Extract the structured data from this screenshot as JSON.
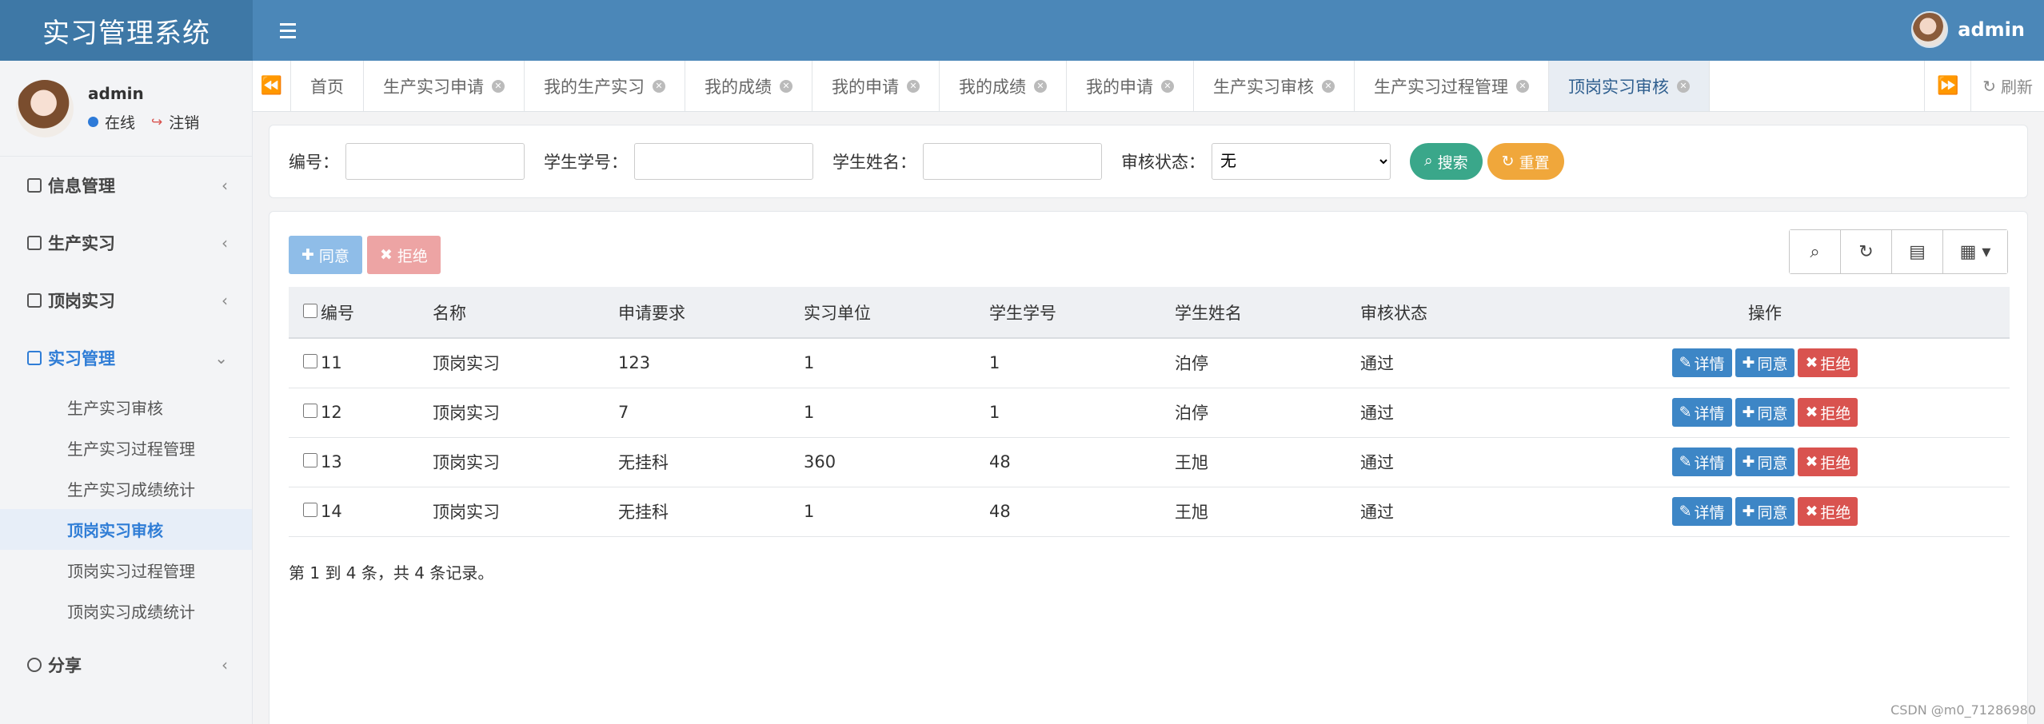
{
  "app": {
    "title": "实习管理系统"
  },
  "header": {
    "username": "admin"
  },
  "profile": {
    "name": "admin",
    "online": "在线",
    "logout": "注销"
  },
  "sidebar": {
    "items": [
      {
        "label": "信息管理"
      },
      {
        "label": "生产实习"
      },
      {
        "label": "顶岗实习"
      },
      {
        "label": "实习管理"
      },
      {
        "label": "分享"
      }
    ],
    "sub": [
      {
        "label": "生产实习审核"
      },
      {
        "label": "生产实习过程管理"
      },
      {
        "label": "生产实习成绩统计"
      },
      {
        "label": "顶岗实习审核"
      },
      {
        "label": "顶岗实习过程管理"
      },
      {
        "label": "顶岗实习成绩统计"
      }
    ]
  },
  "tabs": [
    {
      "label": "首页"
    },
    {
      "label": "生产实习申请"
    },
    {
      "label": "我的生产实习"
    },
    {
      "label": "我的成绩"
    },
    {
      "label": "我的申请"
    },
    {
      "label": "我的成绩"
    },
    {
      "label": "我的申请"
    },
    {
      "label": "生产实习审核"
    },
    {
      "label": "生产实习过程管理"
    },
    {
      "label": "顶岗实习审核"
    }
  ],
  "tabbar": {
    "refresh": "刷新"
  },
  "search": {
    "id_label": "编号：",
    "student_no_label": "学生学号：",
    "student_name_label": "学生姓名：",
    "status_label": "审核状态：",
    "status_value": "无",
    "search_btn": "搜索",
    "reset_btn": "重置"
  },
  "actions": {
    "agree": "同意",
    "reject": "拒绝"
  },
  "table": {
    "headers": [
      "编号",
      "名称",
      "申请要求",
      "实习单位",
      "学生学号",
      "学生姓名",
      "审核状态",
      "操作"
    ],
    "rows": [
      {
        "id": "11",
        "name": "顶岗实习",
        "req": "123",
        "unit": "1",
        "sno": "1",
        "sname": "泊停",
        "status": "通过"
      },
      {
        "id": "12",
        "name": "顶岗实习",
        "req": "7",
        "unit": "1",
        "sno": "1",
        "sname": "泊停",
        "status": "通过"
      },
      {
        "id": "13",
        "name": "顶岗实习",
        "req": "无挂科",
        "unit": "360",
        "sno": "48",
        "sname": "王旭",
        "status": "通过"
      },
      {
        "id": "14",
        "name": "顶岗实习",
        "req": "无挂科",
        "unit": "1",
        "sno": "48",
        "sname": "王旭",
        "status": "通过"
      }
    ],
    "ops": {
      "detail": "详情",
      "agree": "同意",
      "reject": "拒绝"
    }
  },
  "pager": {
    "text": "第 1 到 4 条，共 4 条记录。"
  },
  "watermark": "CSDN @m0_71286980"
}
